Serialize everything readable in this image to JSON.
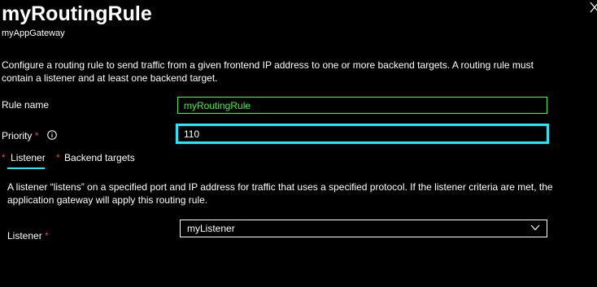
{
  "header": {
    "title": "myRoutingRule",
    "subtitle": "myAppGateway"
  },
  "description": "Configure a routing rule to send traffic from a given frontend IP address to one or more backend targets. A routing rule must contain a listener and at least one backend target.",
  "form": {
    "rule_name": {
      "label": "Rule name",
      "value": "myRoutingRule"
    },
    "priority": {
      "label": "Priority",
      "required_mark": "*",
      "value": "110"
    }
  },
  "tabs": [
    {
      "label": "Listener",
      "required_mark": "*",
      "selected": true
    },
    {
      "label": "Backend targets",
      "required_mark": "*",
      "selected": false
    }
  ],
  "listener_panel": {
    "description": "A listener “listens” on a specified port and IP address for traffic that uses a specified protocol. If the listener criteria are met, the application gateway will apply this routing rule.",
    "listener": {
      "label": "Listener",
      "required_mark": "*",
      "selected": "myListener"
    }
  },
  "colors": {
    "background": "#000000",
    "text": "#ffffff",
    "valid_field": "#3ff23f",
    "focus": "#1aebff",
    "required": "#e0484b"
  },
  "icons": [
    "close-icon",
    "info-icon",
    "chevron-down-icon"
  ]
}
